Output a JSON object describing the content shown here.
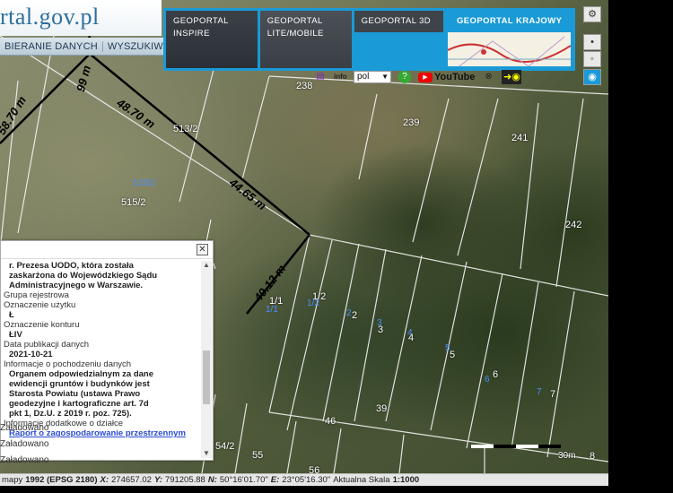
{
  "logo": {
    "text": "rtal.gov.pl"
  },
  "menu": {
    "items": [
      "BIERANIE DANYCH",
      "WYSZUKIWANI"
    ]
  },
  "geoportal_tabs": [
    {
      "line1": "GEOPORTAL",
      "line2": "INSPIRE"
    },
    {
      "line1": "GEOPORTAL",
      "line2": "LITE/MOBILE"
    },
    {
      "line1": "GEOPORTAL 3D",
      "line2": ""
    },
    {
      "line1": "GEOPORTAL KRAJOWY",
      "line2": ""
    }
  ],
  "toolbar": {
    "language": "pol",
    "youtube": "YouTube"
  },
  "map": {
    "dimensions": [
      "58.70 m",
      "48.70 m",
      "44.65 m",
      "40.12 m",
      "99 m"
    ],
    "parcels": [
      "238",
      "239",
      "241",
      "515/2",
      "515/2",
      "513/2",
      "242",
      "1/1",
      "1/2",
      "2",
      "3",
      "4",
      "5",
      "6",
      "7",
      "39",
      "46",
      "54/2",
      "55",
      "56",
      "3",
      "8"
    ],
    "blue_parcels": [
      "515/2",
      "1/1",
      "2",
      "3",
      "4",
      "5",
      "6",
      "7",
      "1/2"
    ],
    "scale_label": "30m"
  },
  "popup": {
    "lines": [
      {
        "text": "r. Prezesa UODO, która została",
        "style": "b"
      },
      {
        "text": "zaskarżona do Wojewódzkiego Sądu",
        "style": "b"
      },
      {
        "text": "Administracyjnego w Warszawie.",
        "style": "b"
      },
      {
        "text": "Grupa rejestrowa",
        "style": ""
      },
      {
        "text": "Oznaczenie użytku",
        "style": ""
      },
      {
        "text": "Ł",
        "style": "b"
      },
      {
        "text": "Oznaczenie konturu",
        "style": ""
      },
      {
        "text": "ŁIV",
        "style": "b"
      },
      {
        "text": "Data publikacji danych",
        "style": ""
      },
      {
        "text": "2021-10-21",
        "style": "b"
      },
      {
        "text": "Informacje o pochodzeniu danych",
        "style": ""
      },
      {
        "text": "Organem odpowiedzialnym za dane",
        "style": "b"
      },
      {
        "text": "ewidencji gruntów i budynków jest",
        "style": "b"
      },
      {
        "text": "Starosta Powiatu (ustawa Prawo",
        "style": "b"
      },
      {
        "text": "geodezyjne i kartograficzne art. 7d",
        "style": "b"
      },
      {
        "text": "pkt 1, Dz.U. z 2019 r. poz. 725).",
        "style": "b"
      },
      {
        "text": "Informacje dodatkowe o działce",
        "style": ""
      }
    ],
    "link_text": "Raport o zagospodarowanie przestrzennym",
    "loading": [
      "Załadowano",
      "Załadowano",
      "Załadowano"
    ]
  },
  "status": {
    "prefix": "mapy",
    "crs": "1992 (EPSG 2180)",
    "x_label": "X:",
    "x_value": "274657.02",
    "y_label": "Y:",
    "y_value": "791205.88",
    "n_label": "N:",
    "n_value": "50°16'01.70\"",
    "e_label": "E:",
    "e_value": "23°05'16.30\"",
    "scale_label": "Aktualna Skala",
    "scale_value": "1:1000"
  }
}
